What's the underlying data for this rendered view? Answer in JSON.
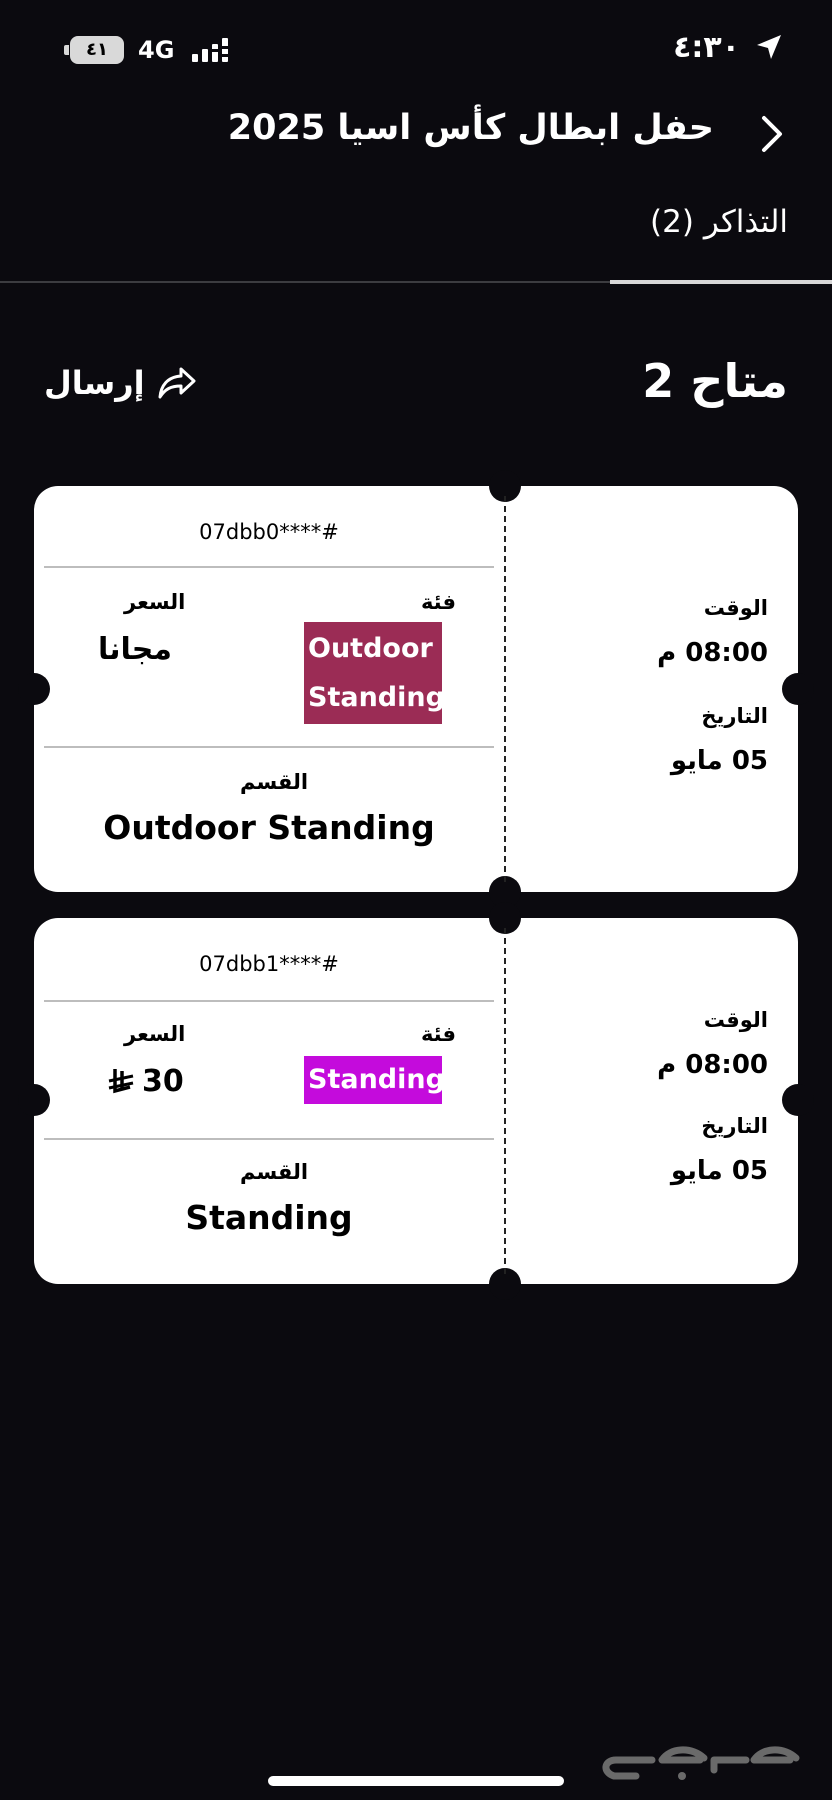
{
  "status_bar": {
    "battery": "٤١",
    "network": "4G",
    "time": "٤:٣٠"
  },
  "header": {
    "title": "حفل ابطال كأس اسيا 2025"
  },
  "tabs": [
    {
      "label": "التذاكر (2)"
    }
  ],
  "section": {
    "available": "متاح 2",
    "send_label": "إرسال"
  },
  "tickets": [
    {
      "id": "07dbb0****#",
      "price_label": "السعر",
      "price": "مجانا",
      "category_label": "فئة",
      "category": "Outdoor Standing",
      "category_color": "#9b2c55",
      "section_label": "القسم",
      "section": "Outdoor Standing",
      "time_label": "الوقت",
      "time": "08:00 م",
      "date_label": "التاريخ",
      "date": "05 مايو"
    },
    {
      "id": "07dbb1****#",
      "price_label": "السعر",
      "price": "30",
      "category_label": "فئة",
      "category": "Standing",
      "category_color": "#c40bdc",
      "section_label": "القسم",
      "section": "Standing",
      "time_label": "الوقت",
      "time": "08:00 م",
      "date_label": "التاريخ",
      "date": "05 مايو"
    }
  ],
  "icons": {
    "back": "chevron-right-icon",
    "send": "share-arrow-icon",
    "currency": "riyal-icon",
    "location": "location-arrow-icon"
  },
  "watermark": "حراج"
}
